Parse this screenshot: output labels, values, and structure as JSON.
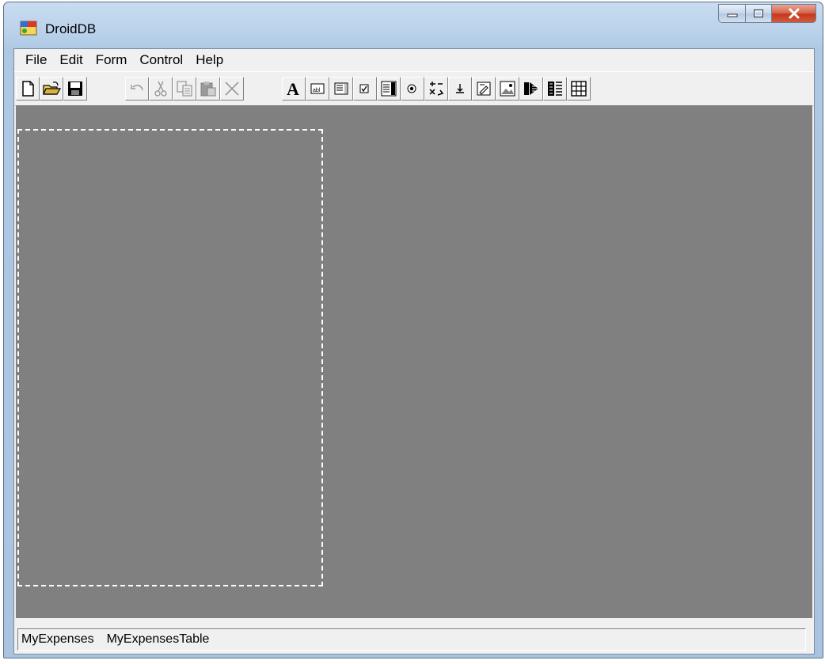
{
  "window": {
    "title": "DroidDB"
  },
  "menu": {
    "items": [
      "File",
      "Edit",
      "Form",
      "Control",
      "Help"
    ]
  },
  "toolbar": {
    "groups": [
      [
        "new-file-icon",
        "open-folder-icon",
        "save-disk-icon"
      ],
      [
        "undo-icon",
        "cut-icon",
        "copy-icon",
        "paste-icon",
        "delete-icon"
      ],
      [
        "label-control-icon",
        "textbox-control-icon",
        "listbox-control-icon",
        "checkbox-control-icon",
        "combobox-control-icon",
        "radio-button-control-icon",
        "spinner-control-icon",
        "button-control-icon",
        "edit-control-icon",
        "image-control-icon",
        "grid-control-icon",
        "multicolumn-control-icon",
        "table-control-icon"
      ]
    ]
  },
  "status": {
    "form_name": "MyExpenses",
    "table_name": "MyExpensesTable"
  },
  "colors": {
    "workspace": "#808080",
    "canvas_border": "#ffffff",
    "close_button": "#c4391f"
  }
}
